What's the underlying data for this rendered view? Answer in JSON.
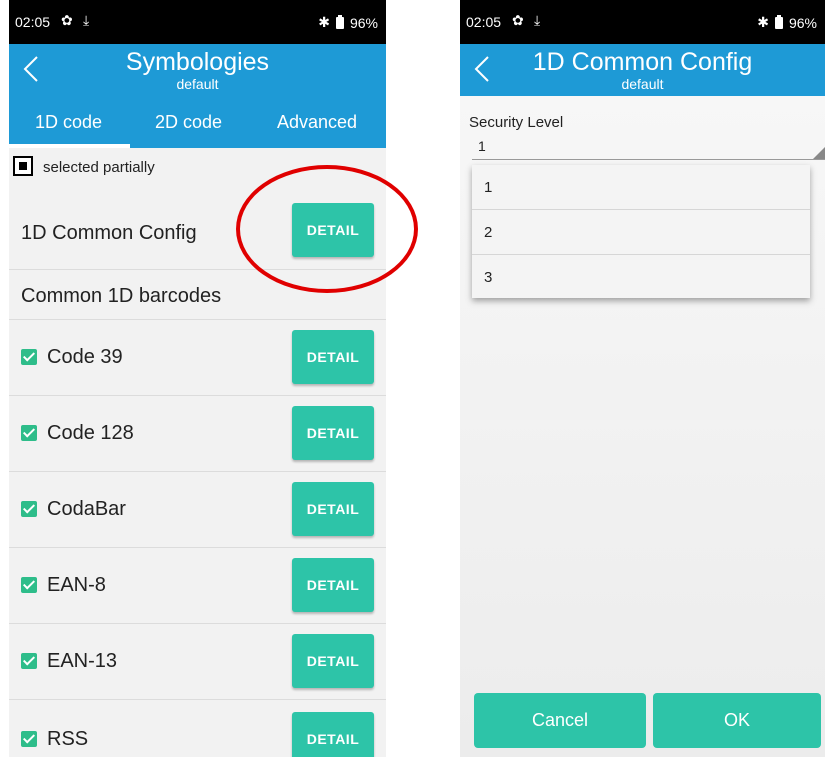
{
  "left_screen": {
    "status": {
      "time": "02:05",
      "battery": "96%"
    },
    "title": "Symbologies",
    "subtitle": "default",
    "tabs": [
      {
        "label": "1D code",
        "active": true
      },
      {
        "label": "2D code"
      },
      {
        "label": "Advanced"
      }
    ],
    "partial_text": "selected partially",
    "common_config_label": "1D Common Config",
    "section_header": "Common 1D barcodes",
    "detail_label": "DETAIL",
    "items": [
      {
        "label": "Code 39",
        "checked": true
      },
      {
        "label": "Code 128",
        "checked": true
      },
      {
        "label": "CodaBar",
        "checked": true
      },
      {
        "label": "EAN-8",
        "checked": true
      },
      {
        "label": "EAN-13",
        "checked": true
      },
      {
        "label": "RSS",
        "checked": true
      }
    ],
    "highlight_color": "#e00000"
  },
  "right_screen": {
    "status": {
      "time": "02:05",
      "battery": "96%"
    },
    "title": "1D Common Config",
    "subtitle": "default",
    "security_label": "Security Level",
    "security_value": "1",
    "options": [
      "1",
      "2",
      "3"
    ],
    "cancel_label": "Cancel",
    "ok_label": "OK"
  },
  "colors": {
    "appbar": "#1e9ad6",
    "button": "#2dc4a8",
    "check": "#2ebd8a"
  }
}
